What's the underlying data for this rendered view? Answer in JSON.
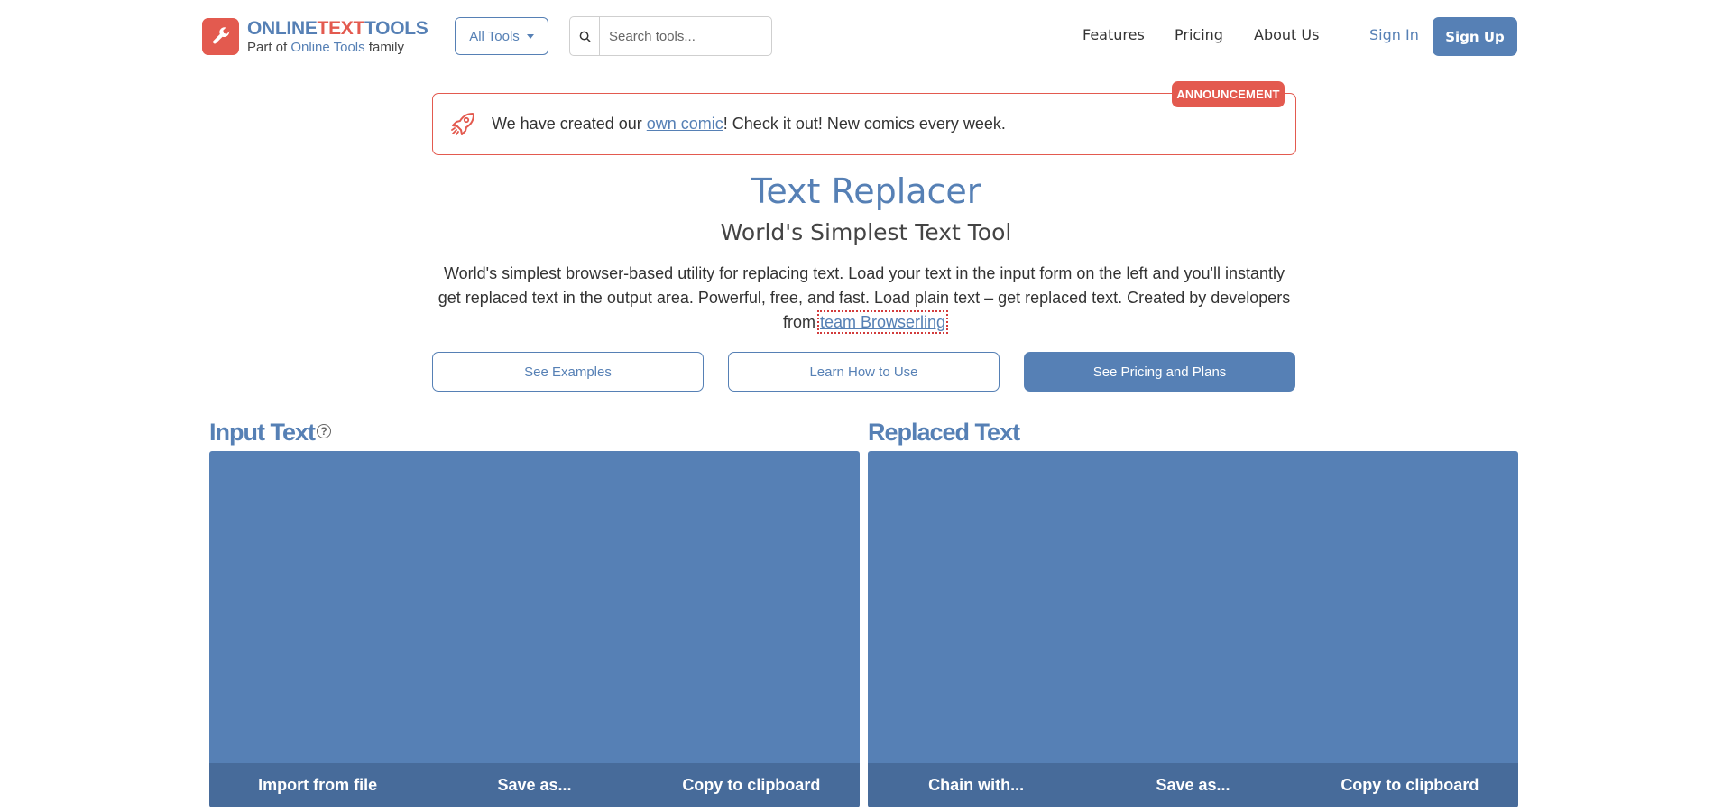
{
  "header": {
    "brand": {
      "part1": "ONLINE",
      "part2": "TEXT",
      "part3": "TOOLS"
    },
    "tagline": {
      "prefix": "Part of ",
      "link": "Online Tools",
      "suffix": " family"
    },
    "all_tools_label": "All Tools",
    "search": {
      "placeholder": "Search tools..."
    },
    "nav": {
      "features": "Features",
      "pricing": "Pricing",
      "about": "About Us"
    },
    "sign_in": "Sign In",
    "sign_up": "Sign Up"
  },
  "announcement": {
    "tag": "ANNOUNCEMENT",
    "text_before": "We have created our ",
    "link": "own comic",
    "text_after": "! Check it out! New comics every week."
  },
  "hero": {
    "title": "Text Replacer",
    "subtitle": "World's Simplest Text Tool",
    "description": "World's simplest browser-based utility for replacing text. Load your text in the input form on the left and you'll instantly get replaced text in the output area. Powerful, free, and fast. Load plain text – get replaced text. Created by developers from ",
    "description_link": "team Browserling",
    "buttons": {
      "examples": "See Examples",
      "how_to": "Learn How to Use",
      "pricing": "See Pricing and Plans"
    }
  },
  "input_panel": {
    "title": "Input Text",
    "help_glyph": "?",
    "value": "",
    "actions": [
      "Import from file",
      "Save as...",
      "Copy to clipboard"
    ]
  },
  "output_panel": {
    "title": "Replaced Text",
    "value": "",
    "actions": [
      "Chain with...",
      "Save as...",
      "Copy to clipboard"
    ]
  },
  "colors": {
    "accent": "#5680b5",
    "accent_dark": "#476b9a",
    "brand_red": "#e35a4f"
  },
  "icons": {
    "logo": "wrench-icon",
    "search": "search-icon",
    "announcement": "rocket-icon",
    "help": "question-circle-icon"
  }
}
